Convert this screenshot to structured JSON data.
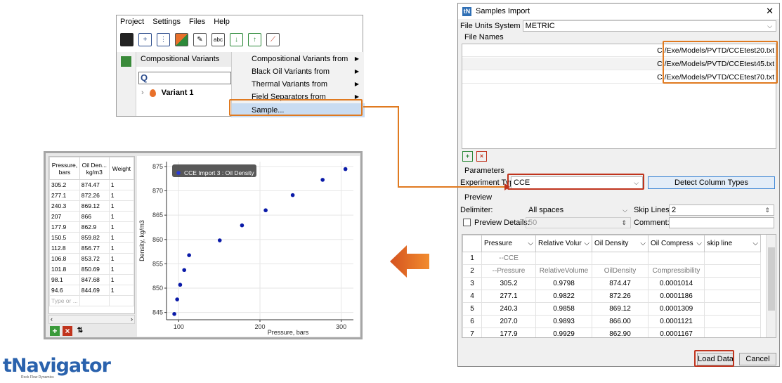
{
  "menu": {
    "bar": [
      "Project",
      "Settings",
      "Files",
      "Help"
    ],
    "panel_title": "Compositional Variants",
    "tree_item": "Variant 1",
    "submenu": [
      {
        "label": "Compositional Variants from",
        "has_arrow": true
      },
      {
        "label": "Black Oil Variants from",
        "has_arrow": true
      },
      {
        "label": "Thermal Variants from",
        "has_arrow": true
      },
      {
        "label": "Field Separators from",
        "has_arrow": true
      },
      {
        "label": "Sample...",
        "has_arrow": false,
        "highlighted": true
      }
    ],
    "toolbar_icons": [
      "save-icon",
      "new-icon",
      "tree-icon",
      "color-icon",
      "edit-icon",
      "abc-icon",
      "import-icon",
      "export-icon",
      "chart-icon"
    ]
  },
  "dialog": {
    "title": "Samples Import",
    "units_label": "File Units System",
    "units_value": "METRIC",
    "file_names_label": "File Names",
    "files": [
      "C:/Exe/Models/PVTD/CCEtest20.txt",
      "C:/Exe/Models/PVTD/CCEtest45.txt",
      "C:/Exe/Models/PVTD/CCEtest70.txt"
    ],
    "parameters_label": "Parameters",
    "experiment_label": "Experiment Type",
    "experiment_value": "CCE",
    "detect_button": "Detect Column Types",
    "preview_label": "Preview",
    "delimiter_label": "Delimiter:",
    "delimiter_value": "All spaces",
    "skip_label": "Skip Lines:",
    "skip_value": "2",
    "preview_details_label": "Preview Details:",
    "preview_details_value": "50",
    "comment_label": "Comment:",
    "columns": [
      "Pressure",
      "Relative Volur",
      "Oil Density",
      "Oil Compress",
      "skip line"
    ],
    "rows": [
      {
        "n": "1",
        "cells": [
          "--CCE",
          "",
          "",
          "",
          ""
        ]
      },
      {
        "n": "2",
        "cells": [
          "--Pressure",
          "RelativeVolume",
          "OilDensity",
          "Compressibility",
          ""
        ]
      },
      {
        "n": "3",
        "cells": [
          "305.2",
          "0.9798",
          "874.47",
          "0.0001014",
          ""
        ]
      },
      {
        "n": "4",
        "cells": [
          "277.1",
          "0.9822",
          "872.26",
          "0.0001186",
          ""
        ]
      },
      {
        "n": "5",
        "cells": [
          "240.3",
          "0.9858",
          "869.12",
          "0.0001309",
          ""
        ]
      },
      {
        "n": "6",
        "cells": [
          "207.0",
          "0.9893",
          "866.00",
          "0.0001121",
          ""
        ]
      },
      {
        "n": "7",
        "cells": [
          "177.9",
          "0.9929",
          "862.90",
          "0.0001167",
          ""
        ]
      }
    ],
    "load_button": "Load Data",
    "cancel_button": "Cancel"
  },
  "data_table": {
    "headers": [
      "Pressure, bars",
      "Oil Den... kg/m3",
      "Weight"
    ],
    "rows": [
      [
        "305.2",
        "874.47",
        "1"
      ],
      [
        "277.1",
        "872.26",
        "1"
      ],
      [
        "240.3",
        "869.12",
        "1"
      ],
      [
        "207",
        "866",
        "1"
      ],
      [
        "177.9",
        "862.9",
        "1"
      ],
      [
        "150.5",
        "859.82",
        "1"
      ],
      [
        "112.8",
        "856.77",
        "1"
      ],
      [
        "106.8",
        "853.72",
        "1"
      ],
      [
        "101.8",
        "850.69",
        "1"
      ],
      [
        "98.1",
        "847.68",
        "1"
      ],
      [
        "94.6",
        "844.69",
        "1"
      ]
    ],
    "placeholder": "Type or ..."
  },
  "chart_data": {
    "type": "scatter",
    "series": [
      {
        "name": "CCE Import 3 : Oil Density",
        "color": "#0a1aa8",
        "x": [
          305.2,
          277.1,
          240.3,
          207,
          177.9,
          150.5,
          112.8,
          106.8,
          101.8,
          98.1,
          94.6
        ],
        "y": [
          874.47,
          872.26,
          869.12,
          866,
          862.9,
          859.82,
          856.77,
          853.72,
          850.69,
          847.68,
          844.69
        ]
      }
    ],
    "xlabel": "Pressure, bars",
    "ylabel": "Density, kg/m3",
    "xlim": [
      85,
      315
    ],
    "ylim": [
      843.5,
      876
    ],
    "xticks": [
      100,
      200,
      300
    ],
    "yticks": [
      845,
      850,
      855,
      860,
      865,
      870,
      875
    ],
    "legend": "top-left",
    "grid": true
  },
  "logo": {
    "text": "tNavigator",
    "subtitle": "Rock Flow Dynamics"
  },
  "colors": {
    "accent_orange": "#e07a20",
    "accent_red": "#c0341d",
    "brand_blue": "#2a62ad"
  }
}
